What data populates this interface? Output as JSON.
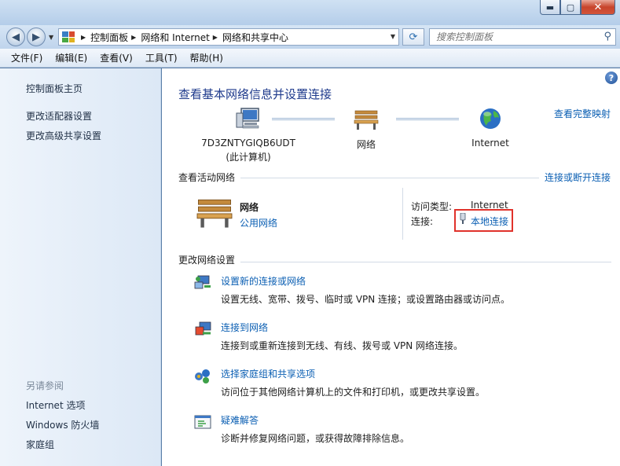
{
  "window": {
    "minimize": "▬",
    "maximize": "▢",
    "close": "✕"
  },
  "nav": {
    "breadcrumbs": [
      "控制面板",
      "网络和 Internet",
      "网络和共享中心"
    ],
    "search_placeholder": "搜索控制面板"
  },
  "menu": [
    "文件(F)",
    "编辑(E)",
    "查看(V)",
    "工具(T)",
    "帮助(H)"
  ],
  "sidebar": {
    "links": [
      "控制面板主页",
      "更改适配器设置",
      "更改高级共享设置"
    ],
    "see_also_header": "另请参阅",
    "see_also": [
      "Internet 选项",
      "Windows 防火墙",
      "家庭组"
    ]
  },
  "main": {
    "title": "查看基本网络信息并设置连接",
    "view_full_map": "查看完整映射",
    "map": {
      "computer_name": "7D3ZNTYGIQB6UDT",
      "computer_sub": "(此计算机)",
      "network": "网络",
      "internet": "Internet"
    },
    "active": {
      "label": "查看活动网络",
      "connect_link": "连接或断开连接",
      "network_name": "网络",
      "network_type": "公用网络",
      "access_label": "访问类型:",
      "access_value": "Internet",
      "connection_label": "连接:",
      "connection_value": "本地连接"
    },
    "change": {
      "label": "更改网络设置",
      "tasks": [
        {
          "title": "设置新的连接或网络",
          "desc": "设置无线、宽带、拨号、临时或 VPN 连接；或设置路由器或访问点。"
        },
        {
          "title": "连接到网络",
          "desc": "连接到或重新连接到无线、有线、拨号或 VPN 网络连接。"
        },
        {
          "title": "选择家庭组和共享选项",
          "desc": "访问位于其他网络计算机上的文件和打印机，或更改共享设置。"
        },
        {
          "title": "疑难解答",
          "desc": "诊断并修复网络问题，或获得故障排除信息。"
        }
      ]
    }
  },
  "colors": {
    "link": "#0b5fb3",
    "title": "#1e3a8c",
    "highlight_box": "#e0322b"
  }
}
